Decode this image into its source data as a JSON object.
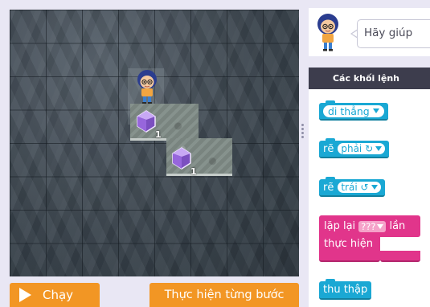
{
  "game": {
    "counts": [
      "1",
      "1"
    ]
  },
  "controls": {
    "run_label": "Chạy",
    "step_label": "Thực hiện từng bước"
  },
  "instructions": {
    "text": "Hãy giúp"
  },
  "toolbox": {
    "title": "Các khối lệnh",
    "blocks": {
      "forward": "di thẳng",
      "turn_right_prefix": "rẽ",
      "turn_right_option": "phải ↻",
      "turn_left_prefix": "rẽ",
      "turn_left_option": "trái ↺",
      "repeat_prefix": "lặp lại",
      "repeat_value": "???",
      "repeat_suffix": "lần",
      "repeat_do": "thực hiện",
      "collect": "thu thập"
    }
  },
  "colors": {
    "accent_orange": "#f29624",
    "motion_block": "#1aa8d4",
    "loop_block": "#e1358b",
    "toolbox_header": "#3d3d4d"
  }
}
